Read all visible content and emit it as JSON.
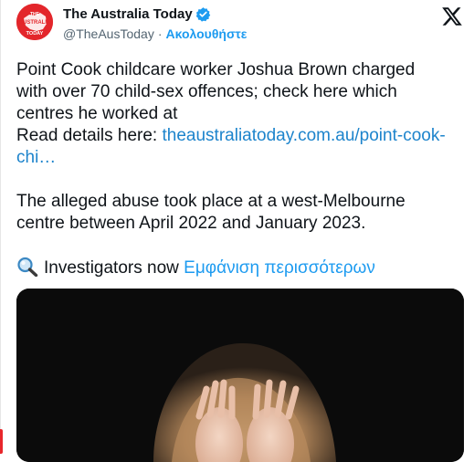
{
  "account": {
    "display_name": "The Australia Today",
    "handle": "@TheAusToday",
    "separator": "·",
    "follow_label": "Ακολουθήστε",
    "avatar_text_line1": "THE",
    "avatar_text_line2": "AUSTRALIA",
    "avatar_text_line3": "TODAY"
  },
  "tweet": {
    "line1": "Point Cook childcare worker Joshua Brown charged",
    "line2": "with over 70 child-sex offences; check here which",
    "line3": "centres he worked at",
    "read_prefix": "Read details here: ",
    "link_part1": "theaustraliatoday.com.au/point-cook-",
    "link_part2": "chi…",
    "line4": "The alleged abuse took place at a west-Melbourne",
    "line5": "centre between April 2022 and January 2023.",
    "investigators_text": "Investigators now ",
    "show_more_label": "Εμφάνιση περισσότερων"
  },
  "icons": {
    "verified": "verified-badge-icon",
    "x_logo": "x-logo-icon",
    "search": "magnifying-glass-icon"
  },
  "colors": {
    "link": "#1d84cc",
    "follow": "#1d9bf0",
    "verified": "#1d9bf0",
    "avatar_bg": "#e3262b"
  }
}
